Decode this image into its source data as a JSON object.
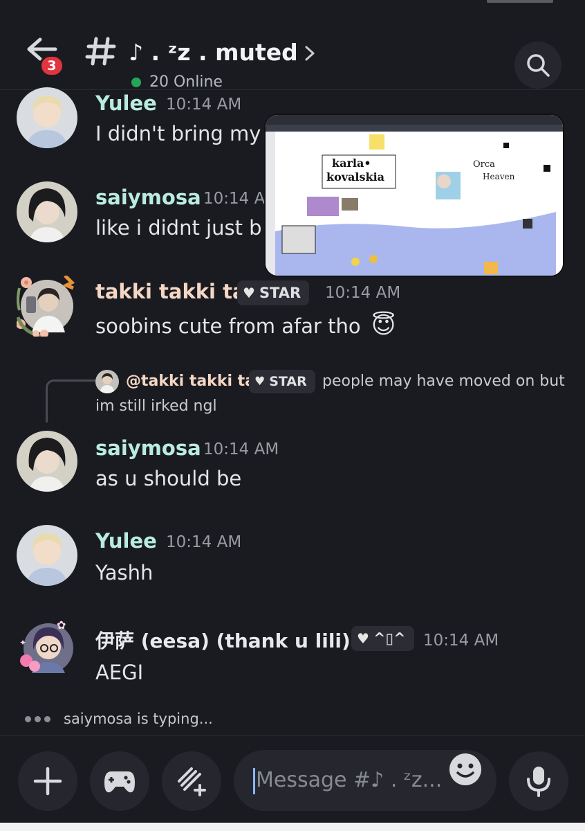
{
  "header": {
    "channel_name": "♪ . ᶻz . muted",
    "online": "20 Online",
    "unread_badge": "3"
  },
  "messages": [
    {
      "author": "Yulee",
      "time": "10:14 AM",
      "text": "I didn't bring my l"
    },
    {
      "author": "saiymosa",
      "time": "10:14 AM",
      "text": "like i didnt just b"
    },
    {
      "author": "takki takki ta",
      "tag": "STAR",
      "time": "10:14 AM",
      "text": "soobins cute from afar tho",
      "emoji": "😇"
    },
    {
      "author": "saiymosa",
      "time": "10:14 AM",
      "text": "as u should be",
      "reply": {
        "author": "@takki takki ta",
        "tag": "STAR",
        "text_line1": "people may have moved on but",
        "text_line2": "im still irked ngl"
      }
    },
    {
      "author": "Yulee",
      "time": "10:14 AM",
      "text": "Yashh"
    },
    {
      "author": "伊萨 (eesa) (thank u lili)",
      "tag": "^▯^",
      "time": "10:14 AM",
      "text": "AEGI"
    }
  ],
  "pip_preview": {
    "label_line1": "karla•",
    "label_line2": "kovalskia",
    "side_text1": "Orca",
    "side_text2": "Heaven"
  },
  "typing": "saiymosa is typing...",
  "composer": {
    "placeholder": "Message #♪ . ᶻz..."
  },
  "colors": {
    "background": "#1a1b21",
    "name_teal": "#b9ecde",
    "name_peach": "#f4d7c4",
    "badge_red": "#e0353e",
    "online_green": "#23a55a"
  },
  "icons": [
    "back-arrow-icon",
    "hash-icon",
    "chevron-right-icon",
    "search-icon",
    "plus-icon",
    "gamepad-icon",
    "apps-sparkle-icon",
    "emoji-icon",
    "microphone-icon",
    "heart-icon"
  ]
}
